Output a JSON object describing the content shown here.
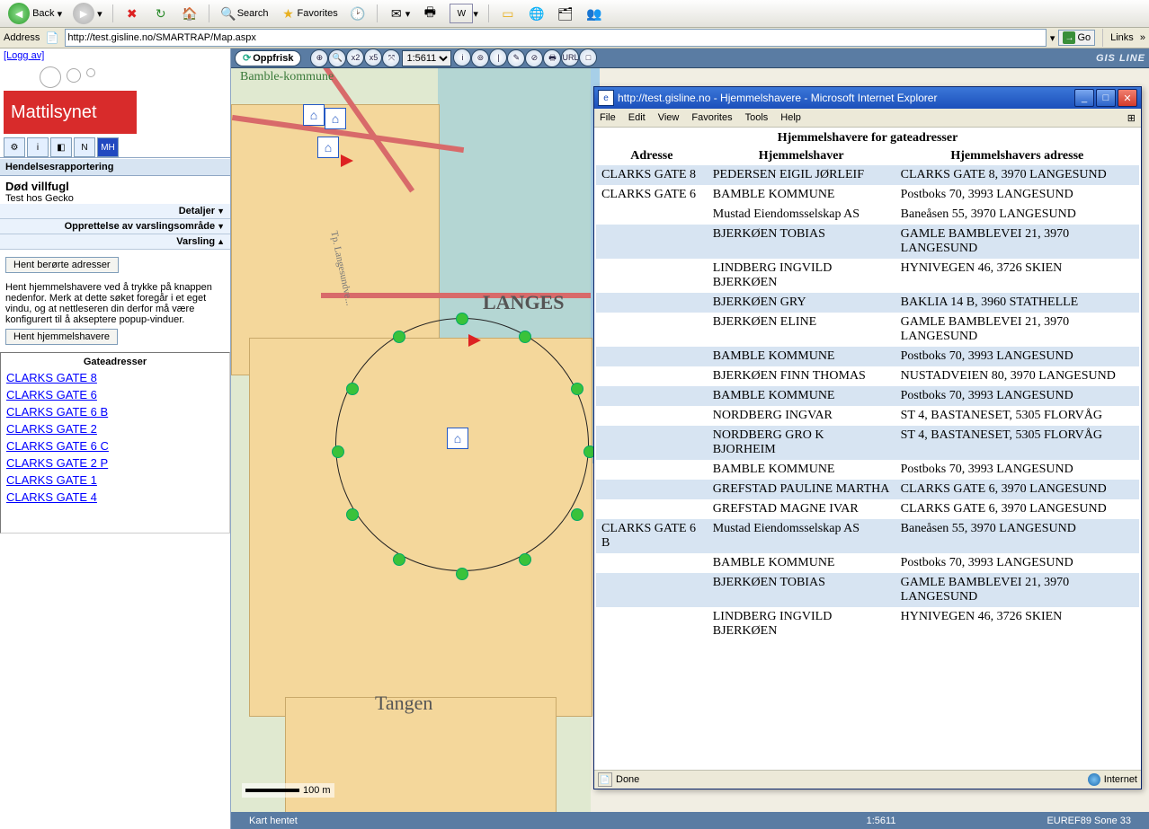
{
  "ie_toolbar": {
    "back": "Back",
    "search": "Search",
    "favorites": "Favorites"
  },
  "address": {
    "label": "Address",
    "url": "http://test.gisline.no/SMARTRAP/Map.aspx",
    "go": "Go",
    "links": "Links"
  },
  "left": {
    "logoff": "[Logg av]",
    "brand": "Mattilsynet",
    "tabs": [
      "⚙",
      "i",
      "◧",
      "N",
      "MH"
    ],
    "panel_title": "Hendelsesrapportering",
    "case_title": "Død villfugl",
    "case_sub": "Test hos Gecko",
    "sec_detaljer": "Detaljer",
    "sec_opprettelse": "Opprettelse av varslingsområde",
    "sec_varsling": "Varsling",
    "btn_hent_adresser": "Hent berørte adresser",
    "help_text": "Hent hjemmelshavere ved å trykke på knappen nedenfor. Merk at dette søket foregår i et eget vindu, og at nettleseren din derfor må være konfigurert til å akseptere popup-vinduer.",
    "btn_hent_hj": "Hent hjemmelshavere",
    "addr_header": "Gateadresser",
    "addresses": [
      "CLARKS GATE 8",
      "CLARKS GATE 6",
      "CLARKS GATE 6 B",
      "CLARKS GATE 2",
      "CLARKS GATE 6 C",
      "CLARKS GATE 2 P",
      "CLARKS GATE 1",
      "CLARKS GATE 4"
    ]
  },
  "gis": {
    "oppfrisk": "Oppfrisk",
    "scale_value": "1:5611",
    "logo": "GIS LINE",
    "tools": [
      "⊕",
      "🔍",
      "x2",
      "x5",
      "⤧",
      "i",
      "⊚",
      "|",
      "✎",
      "⊘",
      "🖶",
      "URL",
      "□"
    ]
  },
  "map": {
    "label_kommune": "Bamble-kommune",
    "label_city": "LANGES",
    "label_tangen": "Tangen",
    "road_label": "Tp. Langesundve...",
    "scale_text": "100 m"
  },
  "status": {
    "left": "Kart hentet",
    "scale": "1:5611",
    "proj": "EUREF89 Sone 33"
  },
  "popup": {
    "title": "http://test.gisline.no - Hjemmelshavere - Microsoft Internet Explorer",
    "menus": [
      "File",
      "Edit",
      "View",
      "Favorites",
      "Tools",
      "Help"
    ],
    "caption": "Hjemmelshavere for gateadresser",
    "cols": [
      "Adresse",
      "Hjemmelshaver",
      "Hjemmelshavers adresse"
    ],
    "rows": [
      {
        "a": "CLARKS GATE 8",
        "h": "PEDERSEN EIGIL JØRLEIF",
        "d": "CLARKS GATE 8, 3970 LANGESUND",
        "s": 1
      },
      {
        "a": "CLARKS GATE 6",
        "h": "BAMBLE KOMMUNE",
        "d": "Postboks 70, 3993 LANGESUND",
        "s": 0
      },
      {
        "a": "",
        "h": "Mustad Eiendomsselskap AS",
        "d": "Baneåsen 55, 3970 LANGESUND",
        "s": 0
      },
      {
        "a": "",
        "h": "BJERKØEN TOBIAS",
        "d": "GAMLE BAMBLEVEI 21, 3970 LANGESUND",
        "s": 1
      },
      {
        "a": "",
        "h": "LINDBERG INGVILD BJERKØEN",
        "d": "HYNIVEGEN 46, 3726 SKIEN",
        "s": 0
      },
      {
        "a": "",
        "h": "BJERKØEN GRY",
        "d": "BAKLIA 14 B, 3960 STATHELLE",
        "s": 1
      },
      {
        "a": "",
        "h": "BJERKØEN ELINE",
        "d": "GAMLE BAMBLEVEI 21, 3970 LANGESUND",
        "s": 0
      },
      {
        "a": "",
        "h": "BAMBLE KOMMUNE",
        "d": "Postboks 70, 3993 LANGESUND",
        "s": 1
      },
      {
        "a": "",
        "h": "BJERKØEN FINN THOMAS",
        "d": "NUSTADVEIEN 80, 3970 LANGESUND",
        "s": 0
      },
      {
        "a": "",
        "h": "BAMBLE KOMMUNE",
        "d": "Postboks 70, 3993 LANGESUND",
        "s": 1
      },
      {
        "a": "",
        "h": "NORDBERG INGVAR",
        "d": "ST 4, BASTANESET, 5305 FLORVÅG",
        "s": 0
      },
      {
        "a": "",
        "h": "NORDBERG GRO K BJORHEIM",
        "d": "ST 4, BASTANESET, 5305 FLORVÅG",
        "s": 1
      },
      {
        "a": "",
        "h": "BAMBLE KOMMUNE",
        "d": "Postboks 70, 3993 LANGESUND",
        "s": 0
      },
      {
        "a": "",
        "h": "GREFSTAD PAULINE MARTHA",
        "d": "CLARKS GATE 6, 3970 LANGESUND",
        "s": 1
      },
      {
        "a": "",
        "h": "GREFSTAD MAGNE IVAR",
        "d": "CLARKS GATE 6, 3970 LANGESUND",
        "s": 0
      },
      {
        "a": "CLARKS GATE 6 B",
        "h": "Mustad Eiendomsselskap AS",
        "d": "Baneåsen 55, 3970 LANGESUND",
        "s": 1
      },
      {
        "a": "",
        "h": "BAMBLE KOMMUNE",
        "d": "Postboks 70, 3993 LANGESUND",
        "s": 0
      },
      {
        "a": "",
        "h": "BJERKØEN TOBIAS",
        "d": "GAMLE BAMBLEVEI 21, 3970 LANGESUND",
        "s": 1
      },
      {
        "a": "",
        "h": "LINDBERG INGVILD BJERKØEN",
        "d": "HYNIVEGEN 46, 3726 SKIEN",
        "s": 0
      }
    ],
    "status_done": "Done",
    "status_zone": "Internet"
  }
}
